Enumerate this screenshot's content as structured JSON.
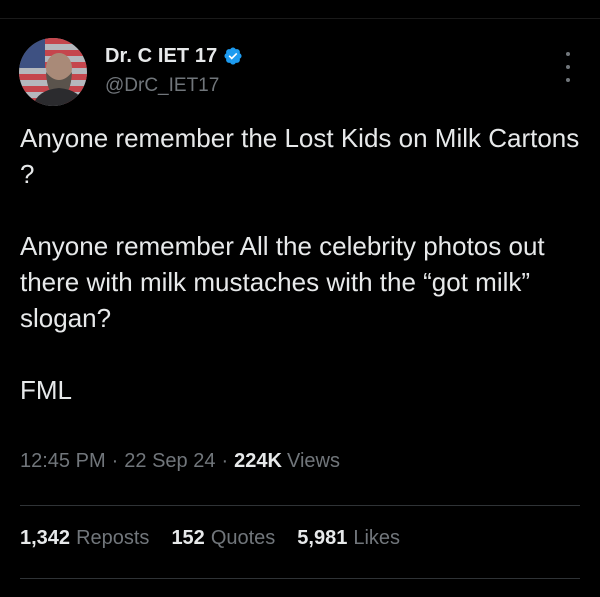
{
  "author": {
    "display_name": "Dr. C IET 17",
    "handle": "@DrC_IET17",
    "verified": true
  },
  "tweet": {
    "text": "Anyone remember the Lost Kids on Milk Cartons ?\n\nAnyone remember All the celebrity photos out there with milk mustaches with the “got milk” slogan?\n\nFML",
    "time": "12:45 PM",
    "date": "22 Sep 24",
    "views_count": "224K",
    "views_label": "Views"
  },
  "stats": {
    "reposts_count": "1,342",
    "reposts_label": "Reposts",
    "quotes_count": "152",
    "quotes_label": "Quotes",
    "likes_count": "5,981",
    "likes_label": "Likes"
  },
  "separator": "·",
  "colors": {
    "background": "#000000",
    "primary_text": "#e7e9ea",
    "secondary_text": "#71767b",
    "verified_badge": "#1d9bf0",
    "divider": "#2f3336"
  },
  "icons": [
    "verified-badge-icon",
    "more-options-icon"
  ]
}
